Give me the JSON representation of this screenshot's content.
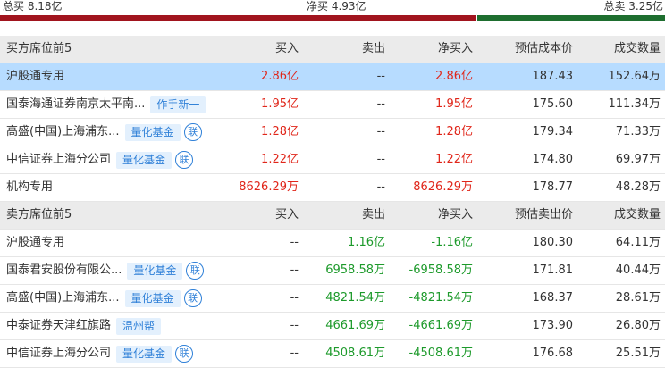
{
  "summary": {
    "buy_total": "总买 8.18亿",
    "net_total": "净买 4.93亿",
    "sell_total": "总卖 3.25亿"
  },
  "buy_header": {
    "name": "买方席位前5",
    "buy": "买入",
    "sell": "卖出",
    "net": "净买入",
    "price": "预估成本价",
    "volume": "成交数量"
  },
  "buy_rows": [
    {
      "name": "沪股通专用",
      "tag": "",
      "link": "",
      "buy": "2.86亿",
      "sell": "--",
      "net": "2.86亿",
      "price": "187.43",
      "volume": "152.64万"
    },
    {
      "name": "国泰海通证券南京太平南...",
      "tag": "作手新一",
      "link": "",
      "buy": "1.95亿",
      "sell": "--",
      "net": "1.95亿",
      "price": "175.60",
      "volume": "111.34万"
    },
    {
      "name": "高盛(中国)上海浦东...",
      "tag": "量化基金",
      "link": "联",
      "buy": "1.28亿",
      "sell": "--",
      "net": "1.28亿",
      "price": "179.34",
      "volume": "71.33万"
    },
    {
      "name": "中信证券上海分公司",
      "tag": "量化基金",
      "link": "联",
      "buy": "1.22亿",
      "sell": "--",
      "net": "1.22亿",
      "price": "174.80",
      "volume": "69.97万"
    },
    {
      "name": "机构专用",
      "tag": "",
      "link": "",
      "buy": "8626.29万",
      "sell": "--",
      "net": "8626.29万",
      "price": "178.77",
      "volume": "48.28万"
    }
  ],
  "sell_header": {
    "name": "卖方席位前5",
    "buy": "买入",
    "sell": "卖出",
    "net": "净买入",
    "price": "预估卖出价",
    "volume": "成交数量"
  },
  "sell_rows": [
    {
      "name": "沪股通专用",
      "tag": "",
      "link": "",
      "buy": "--",
      "sell": "1.16亿",
      "net": "-1.16亿",
      "price": "180.30",
      "volume": "64.11万"
    },
    {
      "name": "国泰君安股份有限公...",
      "tag": "量化基金",
      "link": "联",
      "buy": "--",
      "sell": "6958.58万",
      "net": "-6958.58万",
      "price": "171.81",
      "volume": "40.44万"
    },
    {
      "name": "高盛(中国)上海浦东...",
      "tag": "量化基金",
      "link": "联",
      "buy": "--",
      "sell": "4821.54万",
      "net": "-4821.54万",
      "price": "168.37",
      "volume": "28.61万"
    },
    {
      "name": "中泰证券天津红旗路",
      "tag": "温州帮",
      "link": "",
      "buy": "--",
      "sell": "4661.69万",
      "net": "-4661.69万",
      "price": "173.90",
      "volume": "26.80万"
    },
    {
      "name": "中信证券上海分公司",
      "tag": "量化基金",
      "link": "联",
      "buy": "--",
      "sell": "4508.61万",
      "net": "-4508.61万",
      "price": "176.68",
      "volume": "25.51万"
    }
  ],
  "colors": {
    "buy": "#e0261a",
    "sell": "#1d9a2b",
    "highlight_row": "#b7dcff",
    "tag_bg": "#e3f0fd",
    "tag_text": "#2f80d8",
    "bar_red": "#a1141e",
    "bar_green": "#1e6e2f"
  }
}
